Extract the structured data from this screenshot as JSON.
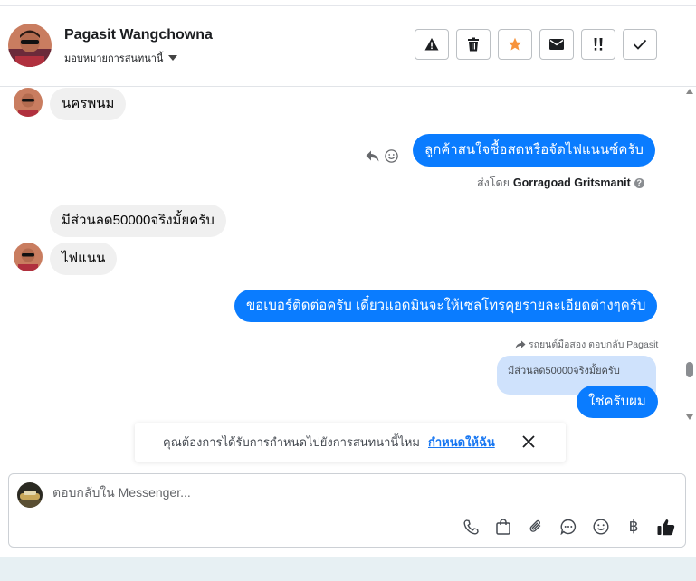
{
  "header": {
    "name": "Pagasit Wangchowna",
    "assign_label": "มอบหมายการสนทนานี้",
    "actions": [
      "spam-warning",
      "delete",
      "star",
      "mark-unread",
      "follow-up",
      "done"
    ],
    "star_color": "#f7923b"
  },
  "messages": {
    "m1": "นครพนม",
    "m2": "ลูกค้าสนใจซื้อสดหรือจัดไฟแนนซ์ครับ",
    "m2_sentby_prefix": "ส่งโดย",
    "m2_sentby_name": "Gorragoad Gritsmanit",
    "m3": "มีส่วนลด50000จริงมั้ยครับ",
    "m4": "ไฟแนน",
    "m5": "ขอเบอร์ติดต่อครับ เดี๋ยวแอดมินจะให้เซลโทรคุยรายละเอียดต่างๆครับ",
    "m6_reply_line": "รถยนต์มือสอง ตอบกลับ Pagasit",
    "m6_quote": "มีส่วนลด50000จริงมั้ยครับ",
    "m6": "ใช่ครับผม"
  },
  "notice": {
    "text": "คุณต้องการได้รับการกำหนดไปยังการสนทนานี้ไหม",
    "link": "กำหนดให้ฉัน"
  },
  "composer": {
    "placeholder": "ตอบกลับใน Messenger...",
    "baht_symbol": "฿"
  },
  "colors": {
    "outgoing": "#0a7cff",
    "incoming": "#f0f0f0",
    "quote": "#cfe2fc",
    "link": "#1877f2"
  }
}
